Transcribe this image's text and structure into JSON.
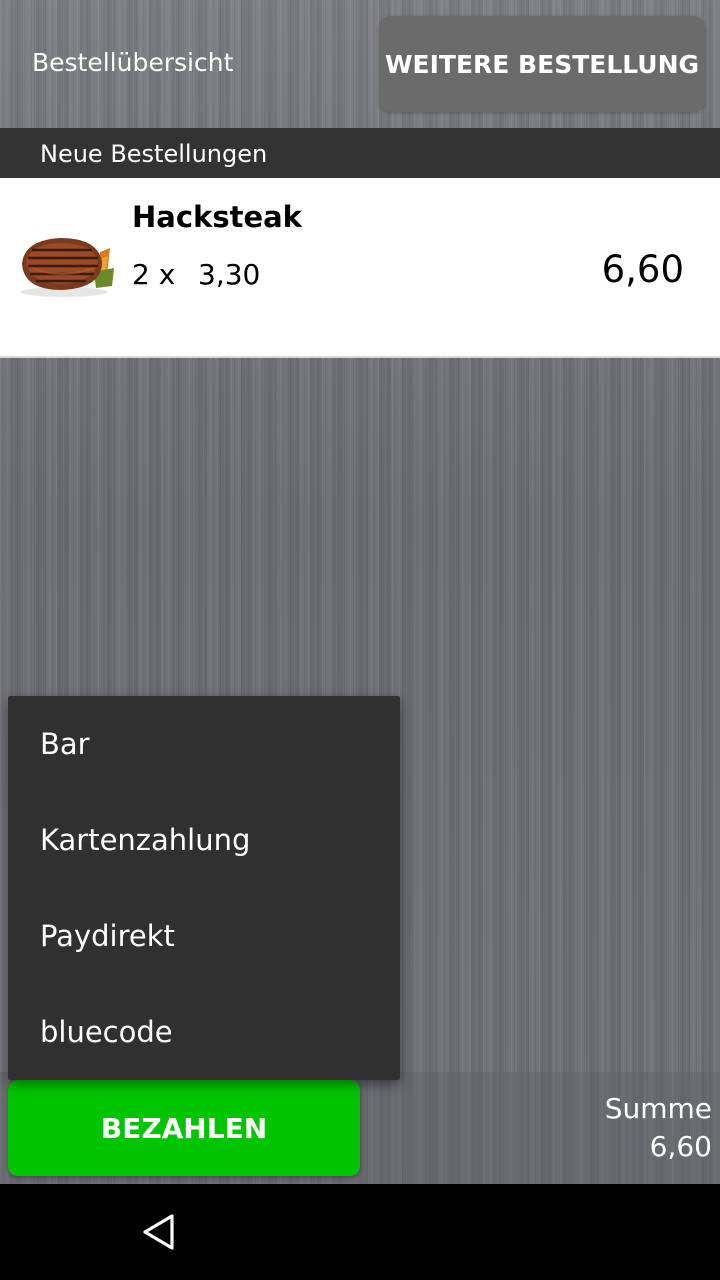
{
  "header": {
    "title": "Bestellübersicht",
    "more_order_label": "WEITERE BESTELLUNG"
  },
  "section": {
    "label": "Neue Bestellungen"
  },
  "order_items": [
    {
      "name": "Hacksteak",
      "quantity": "2 x",
      "unit_price": "3,30",
      "total": "6,60",
      "image_icon": "hacksteak-image"
    }
  ],
  "payment_menu": {
    "items": [
      "Bar",
      "Kartenzahlung",
      "Paydirekt",
      "bluecode"
    ]
  },
  "footer": {
    "pay_label": "BEZAHLEN",
    "sum_label": "Summe",
    "sum_value": "6,60"
  },
  "navigation": {
    "back_icon": "back-triangle-icon"
  },
  "colors": {
    "pay_button": "#00c400",
    "menu_background": "#303030",
    "section_bar": "#333333",
    "more_button": "#6b6b6b"
  }
}
